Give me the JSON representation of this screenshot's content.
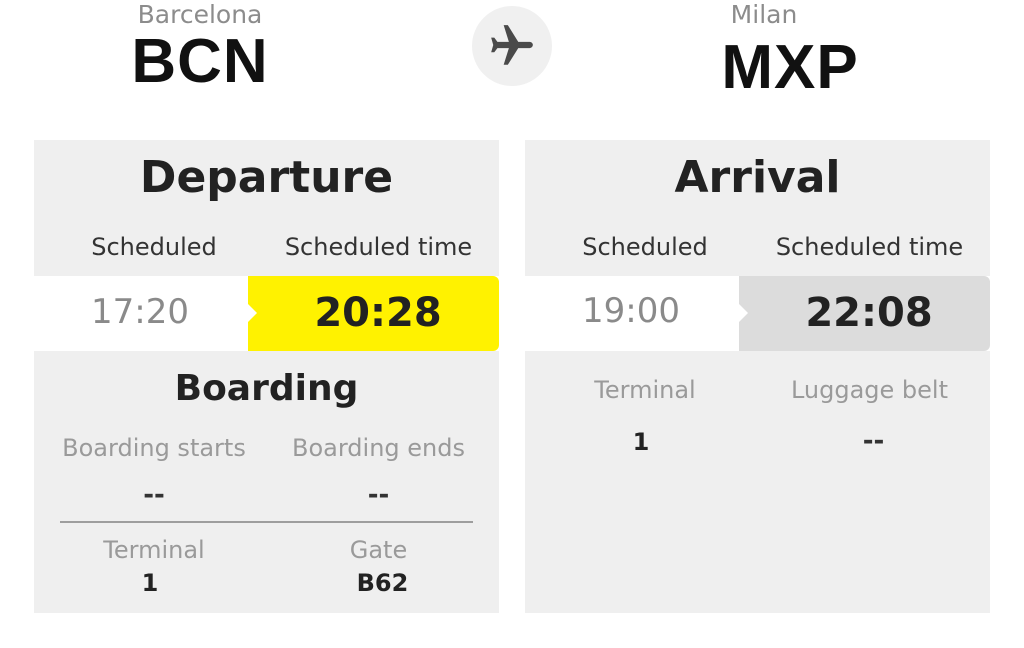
{
  "origin": {
    "city": "Barcelona",
    "code": "BCN"
  },
  "destination": {
    "city": "Milan",
    "code": "MXP"
  },
  "icons": {
    "plane": "airplane-icon"
  },
  "departure": {
    "title": "Departure",
    "scheduled_label": "Scheduled",
    "scheduled_time_label": "Scheduled time",
    "scheduled": "17:20",
    "scheduled_time": "20:28",
    "highlight_color": "#FFF200",
    "boarding": {
      "title": "Boarding",
      "starts_label": "Boarding starts",
      "ends_label": "Boarding ends",
      "starts_value": "--",
      "ends_value": "--",
      "terminal_label": "Terminal",
      "terminal_value": "1",
      "gate_label": "Gate",
      "gate_value": "B62"
    }
  },
  "arrival": {
    "title": "Arrival",
    "scheduled_label": "Scheduled",
    "scheduled_time_label": "Scheduled time",
    "scheduled": "19:00",
    "scheduled_time": "22:08",
    "highlight_color": "#DCDCDC",
    "terminal_label": "Terminal",
    "terminal_value": "1",
    "luggage_label": "Luggage belt",
    "luggage_value": "--"
  }
}
